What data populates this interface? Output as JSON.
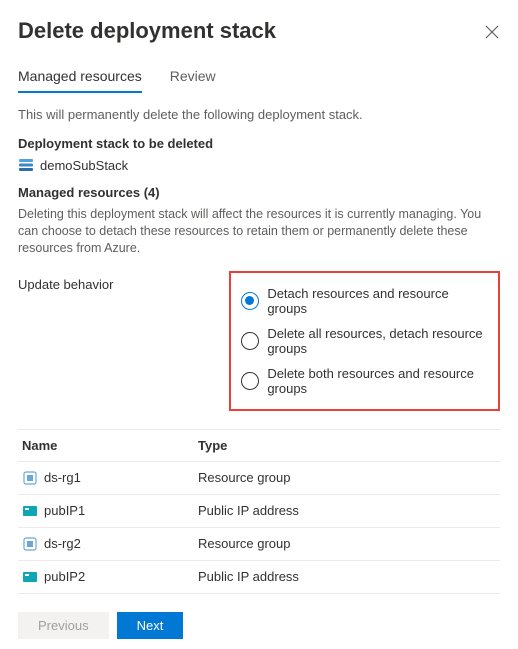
{
  "header": {
    "title": "Delete deployment stack"
  },
  "tabs": {
    "managed": "Managed resources",
    "review": "Review"
  },
  "intro": "This will permanently delete the following deployment stack.",
  "stackSection": {
    "label": "Deployment stack to be deleted",
    "stackName": "demoSubStack"
  },
  "managedResources": {
    "label": "Managed resources (4)",
    "description": "Deleting this deployment stack will affect the resources it is currently managing. You can choose to detach these resources to retain them or permanently delete these resources from Azure."
  },
  "updateBehavior": {
    "label": "Update behavior",
    "options": [
      {
        "text": "Detach resources and resource groups",
        "selected": true
      },
      {
        "text": "Delete all resources, detach resource groups",
        "selected": false
      },
      {
        "text": "Delete both resources and resource groups",
        "selected": false
      }
    ]
  },
  "table": {
    "columns": {
      "name": "Name",
      "type": "Type"
    },
    "rows": [
      {
        "name": "ds-rg1",
        "type": "Resource group",
        "icon": "resource-group"
      },
      {
        "name": "pubIP1",
        "type": "Public IP address",
        "icon": "public-ip"
      },
      {
        "name": "ds-rg2",
        "type": "Resource group",
        "icon": "resource-group"
      },
      {
        "name": "pubIP2",
        "type": "Public IP address",
        "icon": "public-ip"
      }
    ]
  },
  "footer": {
    "previous": "Previous",
    "next": "Next"
  }
}
